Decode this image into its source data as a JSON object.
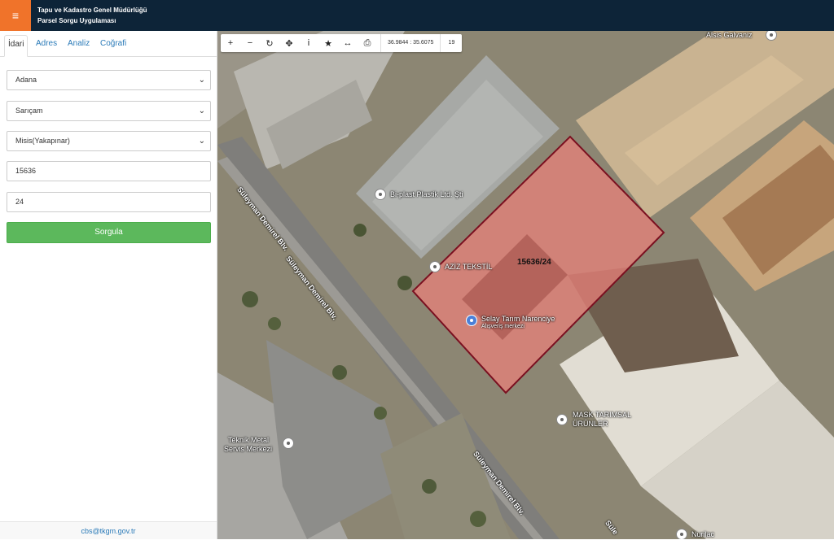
{
  "header": {
    "menu_icon": "≡",
    "title_line1": "Tapu ve Kadastro Genel Müdürlüğü",
    "title_line2": "Parsel Sorgu Uygulaması"
  },
  "sidebar": {
    "tabs": [
      {
        "label": "İdari"
      },
      {
        "label": "Adres"
      },
      {
        "label": "Analiz"
      },
      {
        "label": "Coğrafi"
      }
    ],
    "il": "Adana",
    "ilce": "Sarıçam",
    "mahalle": "Misis(Yakapınar)",
    "ada": "15636",
    "parsel": "24",
    "query_label": "Sorgula",
    "footer_email": "cbs@tkgm.gov.tr"
  },
  "map": {
    "toolbar": {
      "zoom_in": "+",
      "zoom_out": "−",
      "refresh": "↻",
      "pan": "✥",
      "info": "i",
      "favorite": "★",
      "measure": "↔",
      "print": "⎙",
      "coords": "36.9844 : 35.6075",
      "zoom_level": "19"
    },
    "parcel_label": "15636/24",
    "roads": [
      {
        "name": "Süleyman Demirel Blv."
      },
      {
        "name": "Süleyman Demirel Blv."
      },
      {
        "name": "Süleyman Demirel Blv."
      },
      {
        "name": "Süle"
      }
    ],
    "places": [
      {
        "name": "Alsis Galvaniz"
      },
      {
        "name": "Bi-plast Plastik Ltd. Şti"
      },
      {
        "name": "AZİZ TEKSTİL"
      },
      {
        "name": "Selay Tarım Narenciye"
      },
      {
        "name": "Alışveriş merkezi"
      },
      {
        "name": "MASK TARIMSAL"
      },
      {
        "name": "ÜRÜNLER"
      },
      {
        "name": "Teknik Metal"
      },
      {
        "name": "Servis Merkezi"
      },
      {
        "name": "Nurilac"
      }
    ],
    "colors": {
      "parcel_fill": "#e8807a",
      "parcel_stroke": "#7a1020"
    }
  }
}
